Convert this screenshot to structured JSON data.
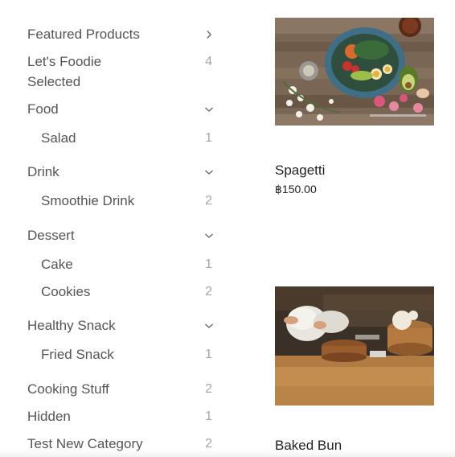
{
  "sidebar": {
    "items": [
      {
        "label": "Featured Products",
        "count": "",
        "chevron": "chevron-right"
      },
      {
        "label": "Let's Foodie Selected",
        "count": "4",
        "chevron": ""
      },
      {
        "label": "Food",
        "count": "",
        "chevron": "chevron-down"
      },
      {
        "label": "Salad",
        "count": "1",
        "chevron": ""
      },
      {
        "label": "Drink",
        "count": "",
        "chevron": "chevron-down"
      },
      {
        "label": "Smoothie Drink",
        "count": "2",
        "chevron": ""
      },
      {
        "label": "Dessert",
        "count": "",
        "chevron": "chevron-down"
      },
      {
        "label": "Cake",
        "count": "1",
        "chevron": ""
      },
      {
        "label": "Cookies",
        "count": "2",
        "chevron": ""
      },
      {
        "label": "Healthy Snack",
        "count": "",
        "chevron": "chevron-down"
      },
      {
        "label": "Fried Snack",
        "count": "1",
        "chevron": ""
      },
      {
        "label": "Cooking Stuff",
        "count": "2",
        "chevron": ""
      },
      {
        "label": "Hidden",
        "count": "1",
        "chevron": ""
      },
      {
        "label": "Test New Category",
        "count": "2",
        "chevron": ""
      }
    ]
  },
  "products": [
    {
      "name": "Spagetti",
      "price": "฿150.00",
      "image": "salad-bowl-photo"
    },
    {
      "name": "Baked Bun",
      "price": "",
      "image": "chef-steamer-photo"
    }
  ]
}
